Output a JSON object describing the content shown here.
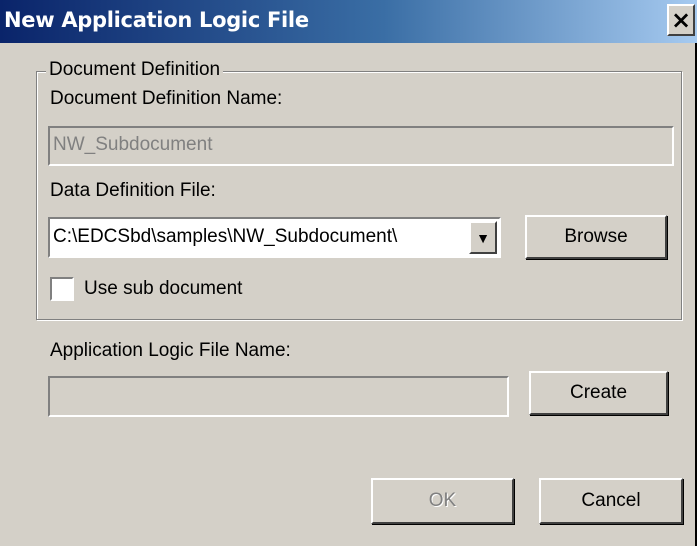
{
  "window": {
    "title": "New Application Logic File",
    "close_glyph": "×"
  },
  "document_definition": {
    "group_label": "Document Definition",
    "name_label": "Document Definition Name:",
    "name_value": "NW_Subdocument",
    "data_file_label": "Data Definition File:",
    "data_file_value": "C:\\EDCSbd\\samples\\NW_Subdocument\\",
    "dropdown_glyph": "▼",
    "browse_label": "Browse",
    "use_sub_label": "Use sub document",
    "use_sub_checked": false
  },
  "app_logic": {
    "name_label": "Application Logic File Name:",
    "name_value": "",
    "create_label": "Create"
  },
  "footer": {
    "ok_label": "OK",
    "cancel_label": "Cancel"
  },
  "colors": {
    "face": "#d4d0c8",
    "title_start": "#0a246a",
    "title_end": "#a6caf0",
    "disabled_text": "#808080"
  }
}
